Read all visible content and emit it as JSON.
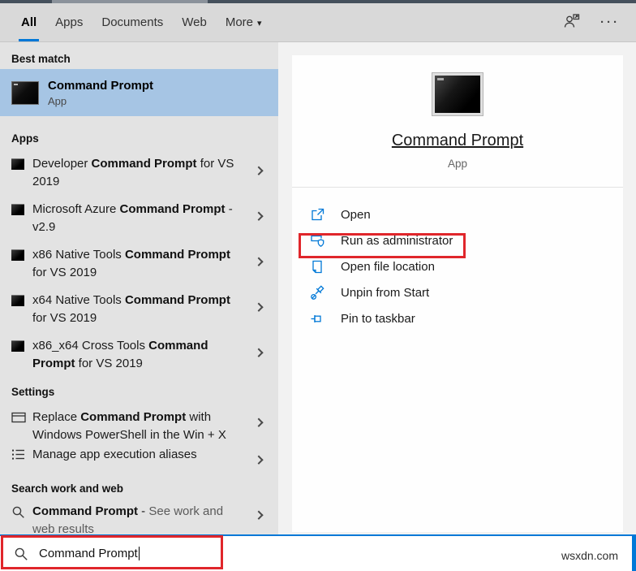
{
  "topbar": {
    "tabs": [
      {
        "label": "All",
        "active": true
      },
      {
        "label": "Apps",
        "active": false
      },
      {
        "label": "Documents",
        "active": false
      },
      {
        "label": "Web",
        "active": false
      },
      {
        "label": "More",
        "active": false
      }
    ],
    "more_arrow": "▾",
    "ellipsis": "···"
  },
  "left_panel": {
    "best_match": {
      "header": "Best match",
      "title": "Command Prompt",
      "subtitle": "App"
    },
    "apps": {
      "header": "Apps",
      "items": [
        {
          "pre": "Developer ",
          "bold": "Command Prompt",
          "post": " for VS 2019"
        },
        {
          "pre": "Microsoft Azure ",
          "bold": "Command Prompt",
          "post": " - v2.9"
        },
        {
          "pre": "x86 Native Tools ",
          "bold": "Command Prompt",
          "post": " for VS 2019"
        },
        {
          "pre": "x64 Native Tools ",
          "bold": "Command Prompt",
          "post": " for VS 2019"
        },
        {
          "pre": "x86_x64 Cross Tools ",
          "bold": "Command Prompt",
          "post": " for VS 2019"
        }
      ]
    },
    "settings": {
      "header": "Settings",
      "items": [
        {
          "pre": "Replace ",
          "bold": "Command Prompt",
          "post": " with Windows PowerShell in the Win + X"
        },
        {
          "pre": "",
          "bold": "",
          "post": "Manage app execution aliases"
        }
      ]
    },
    "search_web": {
      "header": "Search work and web",
      "item": {
        "bold": "Command Prompt",
        "sep": " - ",
        "gray": "See work and web results"
      }
    }
  },
  "preview_panel": {
    "title": "Command Prompt",
    "subtitle": "App",
    "actions": [
      {
        "label": "Open",
        "highlighted": false
      },
      {
        "label": "Run as administrator",
        "highlighted": true
      },
      {
        "label": "Open file location",
        "highlighted": false
      },
      {
        "label": "Unpin from Start",
        "highlighted": false
      },
      {
        "label": "Pin to taskbar",
        "highlighted": false
      }
    ]
  },
  "search_bar": {
    "value": "Command Prompt"
  },
  "watermark": "wsxdn.com",
  "colors": {
    "accent": "#0078d7",
    "best_match_highlight": "#a6c5e4",
    "red_annotation": "#e0262b",
    "action_icon_blue": "#0078d7",
    "topbar_bg": "#d9d9d9",
    "left_panel_bg": "#e3e3e3"
  }
}
